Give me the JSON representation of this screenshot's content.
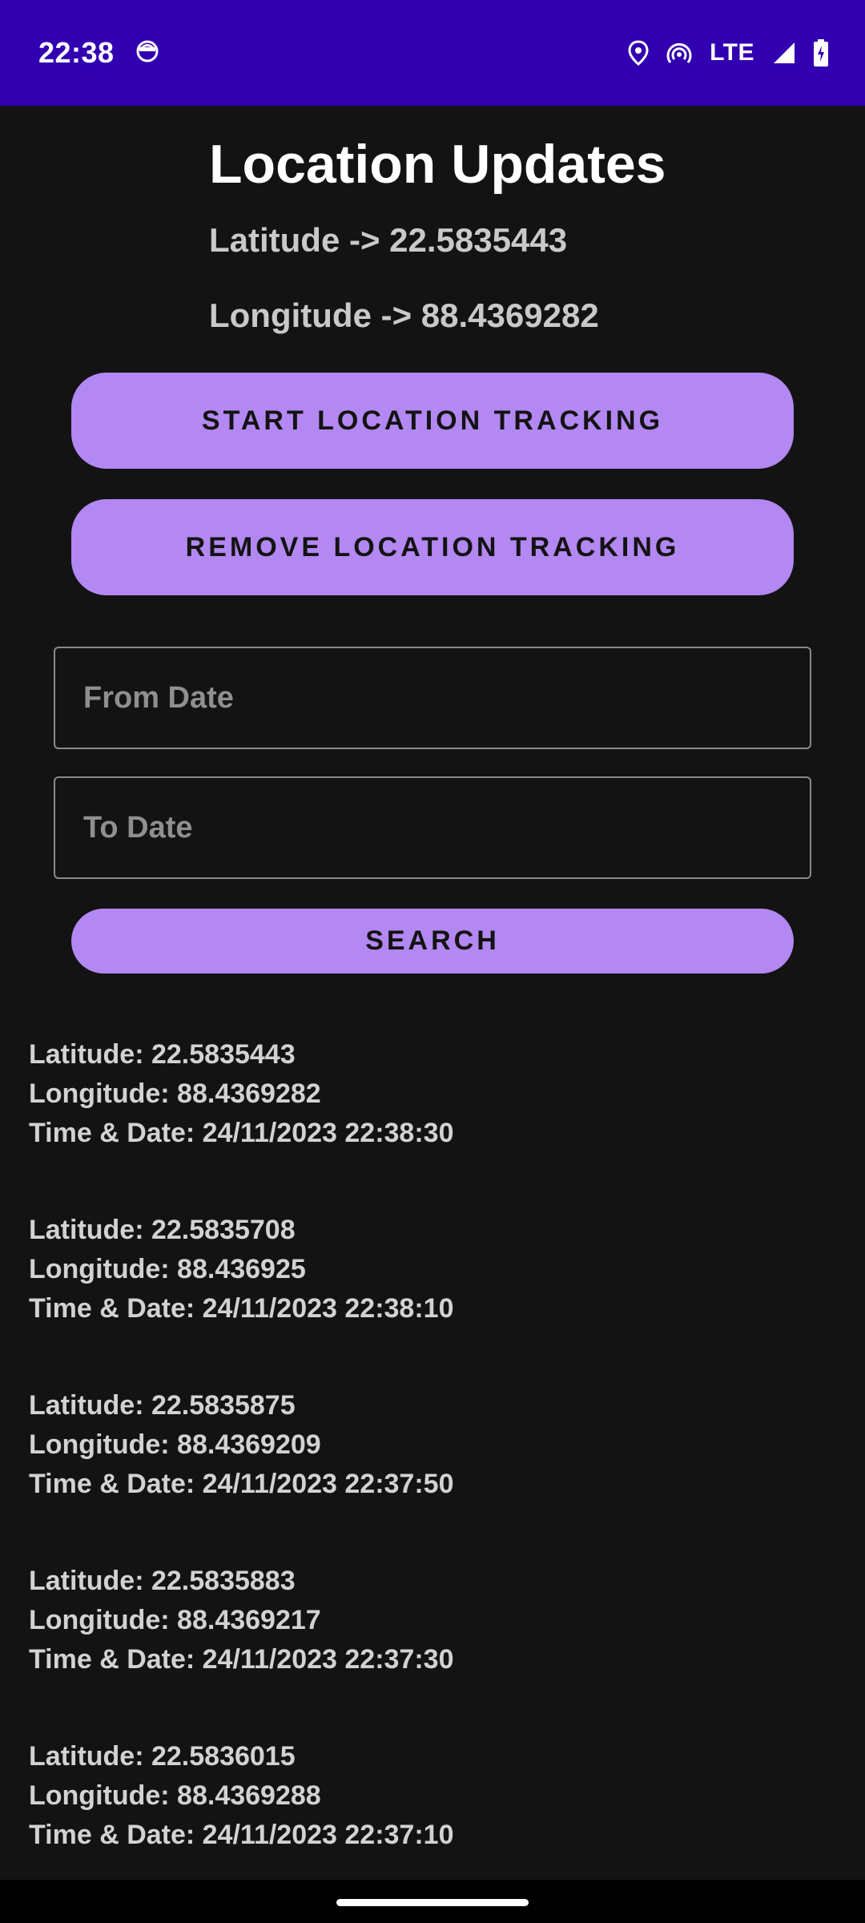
{
  "status_bar": {
    "time": "22:38",
    "network": "LTE",
    "icons": [
      "face-notification-icon",
      "location-pin-icon",
      "hotspot-icon",
      "signal-icon",
      "battery-charging-icon"
    ]
  },
  "header": {
    "title": "Location Updates",
    "latitude": "Latitude -> 22.5835443",
    "longitude": "Longitude -> 88.4369282"
  },
  "buttons": {
    "start": "START LOCATION TRACKING",
    "remove": "REMOVE LOCATION TRACKING",
    "search": "SEARCH"
  },
  "inputs": {
    "from_date": {
      "placeholder": "From Date",
      "value": ""
    },
    "to_date": {
      "placeholder": "To Date",
      "value": ""
    }
  },
  "records": [
    {
      "latitude": "Latitude: 22.5835443",
      "longitude": "Longitude: 88.4369282",
      "datetime": "Time & Date: 24/11/2023 22:38:30"
    },
    {
      "latitude": "Latitude: 22.5835708",
      "longitude": "Longitude: 88.436925",
      "datetime": "Time & Date: 24/11/2023 22:38:10"
    },
    {
      "latitude": "Latitude: 22.5835875",
      "longitude": "Longitude: 88.4369209",
      "datetime": "Time & Date: 24/11/2023 22:37:50"
    },
    {
      "latitude": "Latitude: 22.5835883",
      "longitude": "Longitude: 88.4369217",
      "datetime": "Time & Date: 24/11/2023 22:37:30"
    },
    {
      "latitude": "Latitude: 22.5836015",
      "longitude": "Longitude: 88.4369288",
      "datetime": "Time & Date: 24/11/2023 22:37:10"
    }
  ],
  "colors": {
    "status_bar": "#3200b0",
    "background": "#131313",
    "button": "#b388f2",
    "text_muted": "#c9c9c9"
  }
}
